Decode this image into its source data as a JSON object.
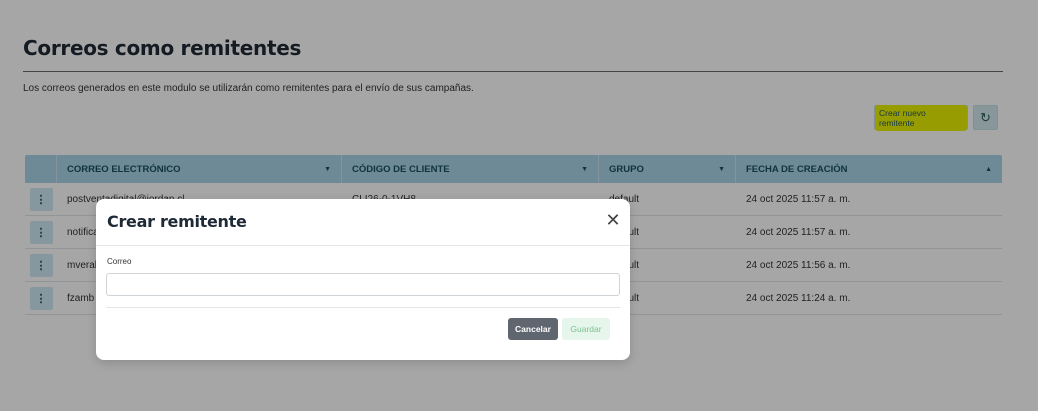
{
  "page": {
    "title": "Correos como remitentes",
    "description": "Los correos generados en este modulo se utilizarán como remitentes para el envío de sus campañas."
  },
  "toolbar": {
    "new_sender_label": "Crear nuevo remitente",
    "refresh_icon": "refresh-icon",
    "highlight_color": "#e8f000"
  },
  "table": {
    "columns": [
      "CORREO ELECTRÓNICO",
      "CÓDIGO DE CLIENTE",
      "GRUPO",
      "FECHA DE CREACIÓN"
    ],
    "rows": [
      {
        "email": "postventadigital@jordan.cl",
        "client_code": "CLI26-0-1VH8",
        "group": "default",
        "created": "24 oct 2025 11:57 a. m."
      },
      {
        "email": "notifica",
        "client_code": "",
        "group": "default",
        "created": "24 oct 2025 11:57 a. m."
      },
      {
        "email": "mveral",
        "client_code": "",
        "group": "default",
        "created": "24 oct 2025 11:56 a. m."
      },
      {
        "email": "fzamb",
        "client_code": "",
        "group": "default",
        "created": "24 oct 2025 11:24 a. m."
      }
    ]
  },
  "modal": {
    "title": "Crear remitente",
    "field_label": "Correo",
    "field_value": "",
    "field_placeholder": "",
    "cancel_label": "Cancelar",
    "save_label": "Guardar"
  },
  "colors": {
    "header_bg": "#a9d4e6",
    "overlay": "rgba(0,0,0,0.35)",
    "cancel_bg": "#5f6670",
    "save_bg": "#e7f6ec"
  }
}
